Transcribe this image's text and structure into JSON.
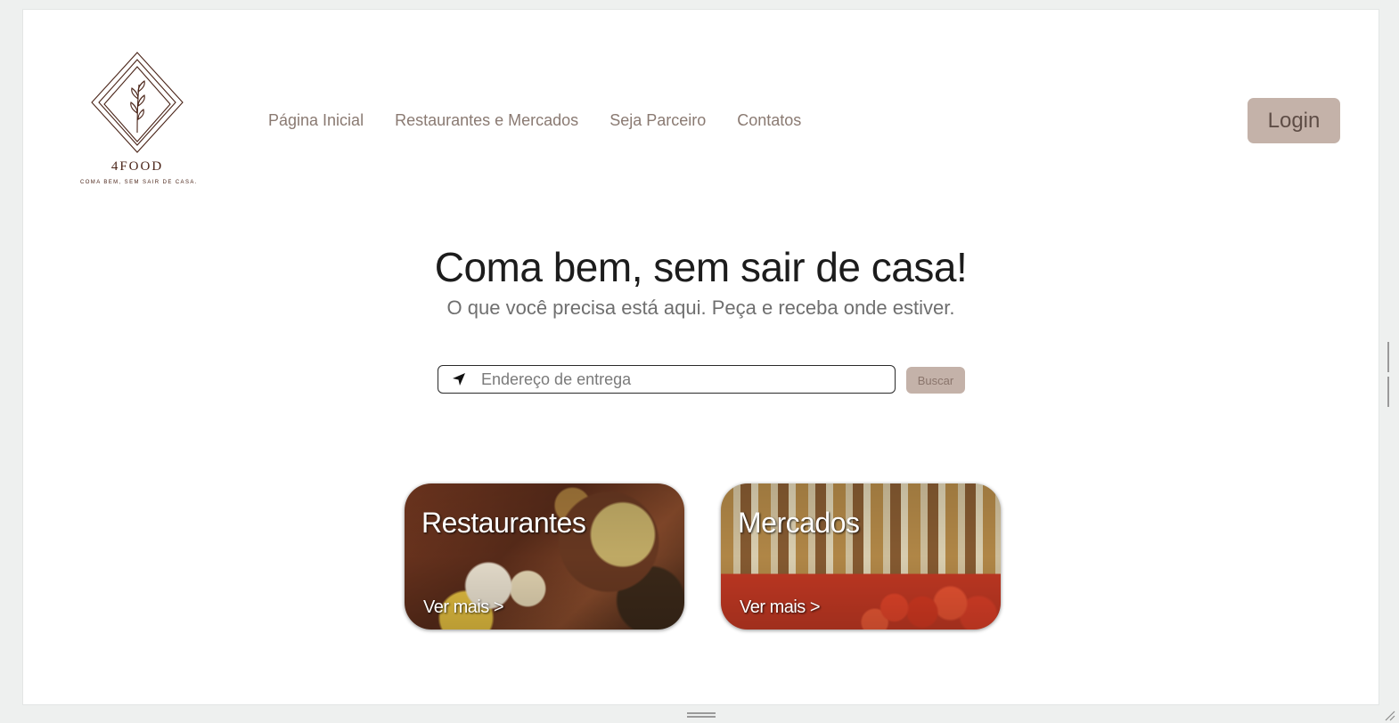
{
  "logo": {
    "name": "4FOOD",
    "tagline": "COMA BEM, SEM SAIR DE CASA."
  },
  "nav": {
    "items": [
      {
        "label": "Página Inicial"
      },
      {
        "label": "Restaurantes e Mercados"
      },
      {
        "label": "Seja Parceiro"
      },
      {
        "label": "Contatos"
      }
    ]
  },
  "header": {
    "login_label": "Login"
  },
  "hero": {
    "title": "Coma bem, sem sair de casa!",
    "subtitle": "O que você precisa está aqui. Peça e receba onde estiver."
  },
  "search": {
    "placeholder": "Endereço de entrega",
    "value": "",
    "icon": "navigation-arrow-icon",
    "button_label": "Buscar"
  },
  "cards": [
    {
      "title": "Restaurantes",
      "link_label": "Ver mais >"
    },
    {
      "title": "Mercados",
      "link_label": "Ver mais >"
    }
  ],
  "colors": {
    "accent": "#c4b2a9",
    "brand_text": "#4a2418",
    "nav_text": "#8a7a72"
  }
}
